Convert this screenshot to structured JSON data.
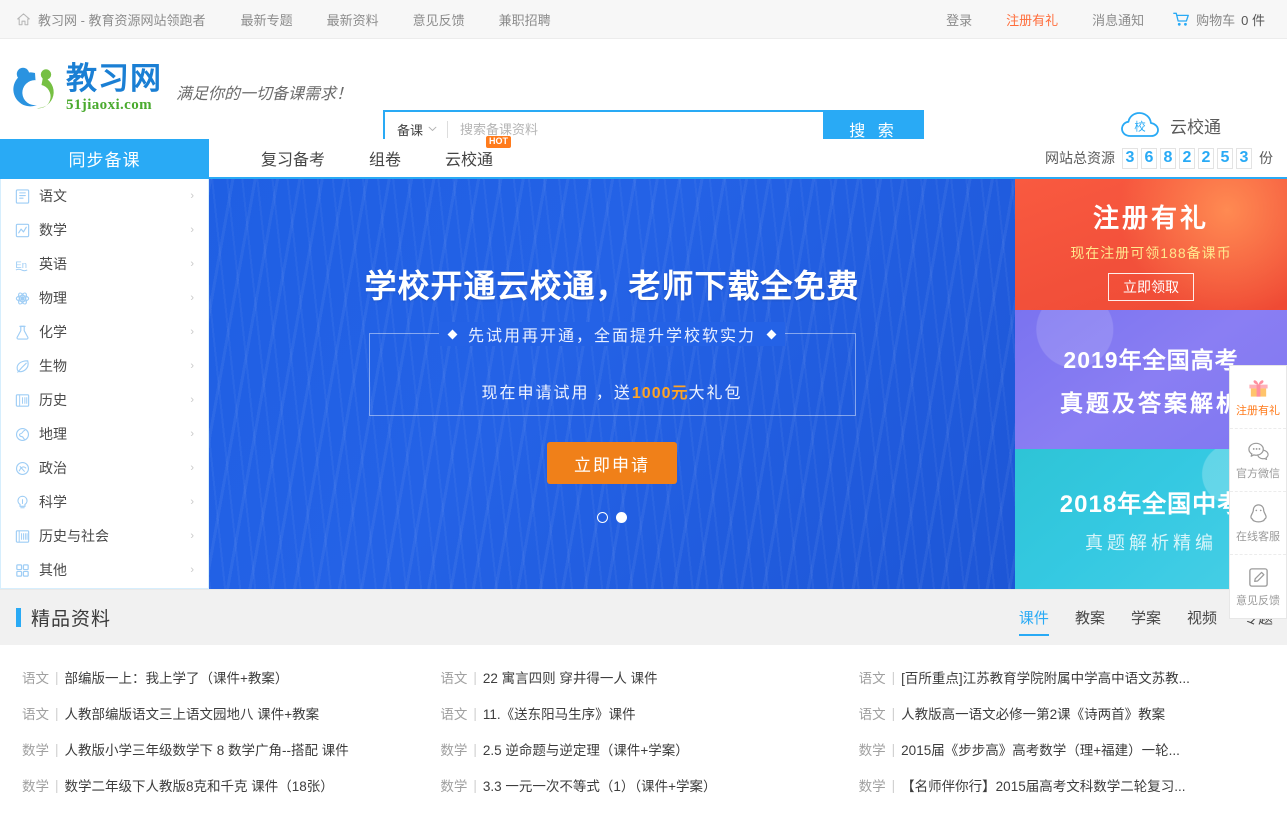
{
  "topbar": {
    "home_label": "教习网 - 教育资源网站领跑者",
    "links": [
      "最新专题",
      "最新资料",
      "意见反馈",
      "兼职招聘"
    ],
    "login": "登录",
    "register": "注册有礼",
    "messages": "消息通知",
    "cart": "购物车",
    "cart_count": "0 件"
  },
  "header": {
    "logo_cn": "教习网",
    "logo_en": "51jiaoxi.com",
    "slogan": "满足你的一切备课需求！",
    "yunxiaotong": "云校通",
    "cloud_badge": "校"
  },
  "search": {
    "category": "备课",
    "placeholder": "搜索备课资料",
    "value": "",
    "button": "搜 索"
  },
  "nav": {
    "category_button": "同步备课",
    "items": [
      {
        "label": "复习备考",
        "badge": ""
      },
      {
        "label": "组卷",
        "badge": ""
      },
      {
        "label": "云校通",
        "badge": "HOT"
      }
    ],
    "counter_label": "网站总资源",
    "counter_digits": [
      "3",
      "6",
      "8",
      "2",
      "2",
      "5",
      "3"
    ],
    "counter_unit": "份"
  },
  "subjects": [
    {
      "label": "语文",
      "icon": "book-icon"
    },
    {
      "label": "数学",
      "icon": "chart-icon"
    },
    {
      "label": "英语",
      "icon": "english-icon"
    },
    {
      "label": "物理",
      "icon": "atom-icon"
    },
    {
      "label": "化学",
      "icon": "flask-icon"
    },
    {
      "label": "生物",
      "icon": "leaf-icon"
    },
    {
      "label": "历史",
      "icon": "scroll-icon"
    },
    {
      "label": "地理",
      "icon": "globe-icon"
    },
    {
      "label": "政治",
      "icon": "balance-icon"
    },
    {
      "label": "科学",
      "icon": "bulb-icon"
    },
    {
      "label": "历史与社会",
      "icon": "books-icon"
    },
    {
      "label": "其他",
      "icon": "grid-icon"
    }
  ],
  "banner": {
    "title": "学校开通云校通，老师下载全免费",
    "subtitle": "先试用再开通，全面提升学校软实力",
    "line2_prefix": "现在申请试用 ，送",
    "line2_highlight": "1000元",
    "line2_suffix": "大礼包",
    "cta": "立即申请",
    "active_dot": 1
  },
  "promos": {
    "red": {
      "title": "注册有礼",
      "subtitle": "现在注册可领188备课币",
      "button": "立即领取"
    },
    "purple": {
      "line1": "2019年全国高考",
      "line2": "真题及答案解析"
    },
    "cyan": {
      "line1": "2018年全国中考",
      "line2": "真题解析精编"
    }
  },
  "rail": [
    {
      "label": "注册有礼",
      "icon": "gift-icon",
      "hot": true
    },
    {
      "label": "官方微信",
      "icon": "wechat-icon",
      "hot": false
    },
    {
      "label": "在线客服",
      "icon": "qq-icon",
      "hot": false
    },
    {
      "label": "意见反馈",
      "icon": "pencil-icon",
      "hot": false
    }
  ],
  "featured": {
    "title": "精品资料",
    "tabs": [
      "课件",
      "教案",
      "学案",
      "视频",
      "专题"
    ],
    "active_tab": 0,
    "separator": "|",
    "items": [
      {
        "subject": "语文",
        "title": "部编版一上：我上学了（课件+教案）"
      },
      {
        "subject": "语文",
        "title": "22 寓言四则 穿井得一人 课件"
      },
      {
        "subject": "语文",
        "title": "[百所重点]江苏教育学院附属中学高中语文苏教..."
      },
      {
        "subject": "语文",
        "title": "人教部编版语文三上语文园地八 课件+教案"
      },
      {
        "subject": "语文",
        "title": "11.《送东阳马生序》课件"
      },
      {
        "subject": "语文",
        "title": "人教版高一语文必修一第2课《诗两首》教案"
      },
      {
        "subject": "数学",
        "title": "人教版小学三年级数学下 8 数学广角--搭配 课件"
      },
      {
        "subject": "数学",
        "title": "2.5 逆命题与逆定理（课件+学案）"
      },
      {
        "subject": "数学",
        "title": "2015届《步步高》高考数学（理+福建）一轮..."
      },
      {
        "subject": "数学",
        "title": "数学二年级下人教版8克和千克 课件（18张）"
      },
      {
        "subject": "数学",
        "title": "3.3 一元一次不等式（1）（课件+学案）"
      },
      {
        "subject": "数学",
        "title": "【名师伴你行】2015届高考文科数学二轮复习..."
      }
    ]
  },
  "colors": {
    "accent": "#29aaf5",
    "orange": "#ff6d3b",
    "banner_blue": "#2462e6",
    "promo_red": "#f2503a",
    "promo_purple": "#8a7ef3",
    "promo_cyan": "#35c9e2"
  }
}
